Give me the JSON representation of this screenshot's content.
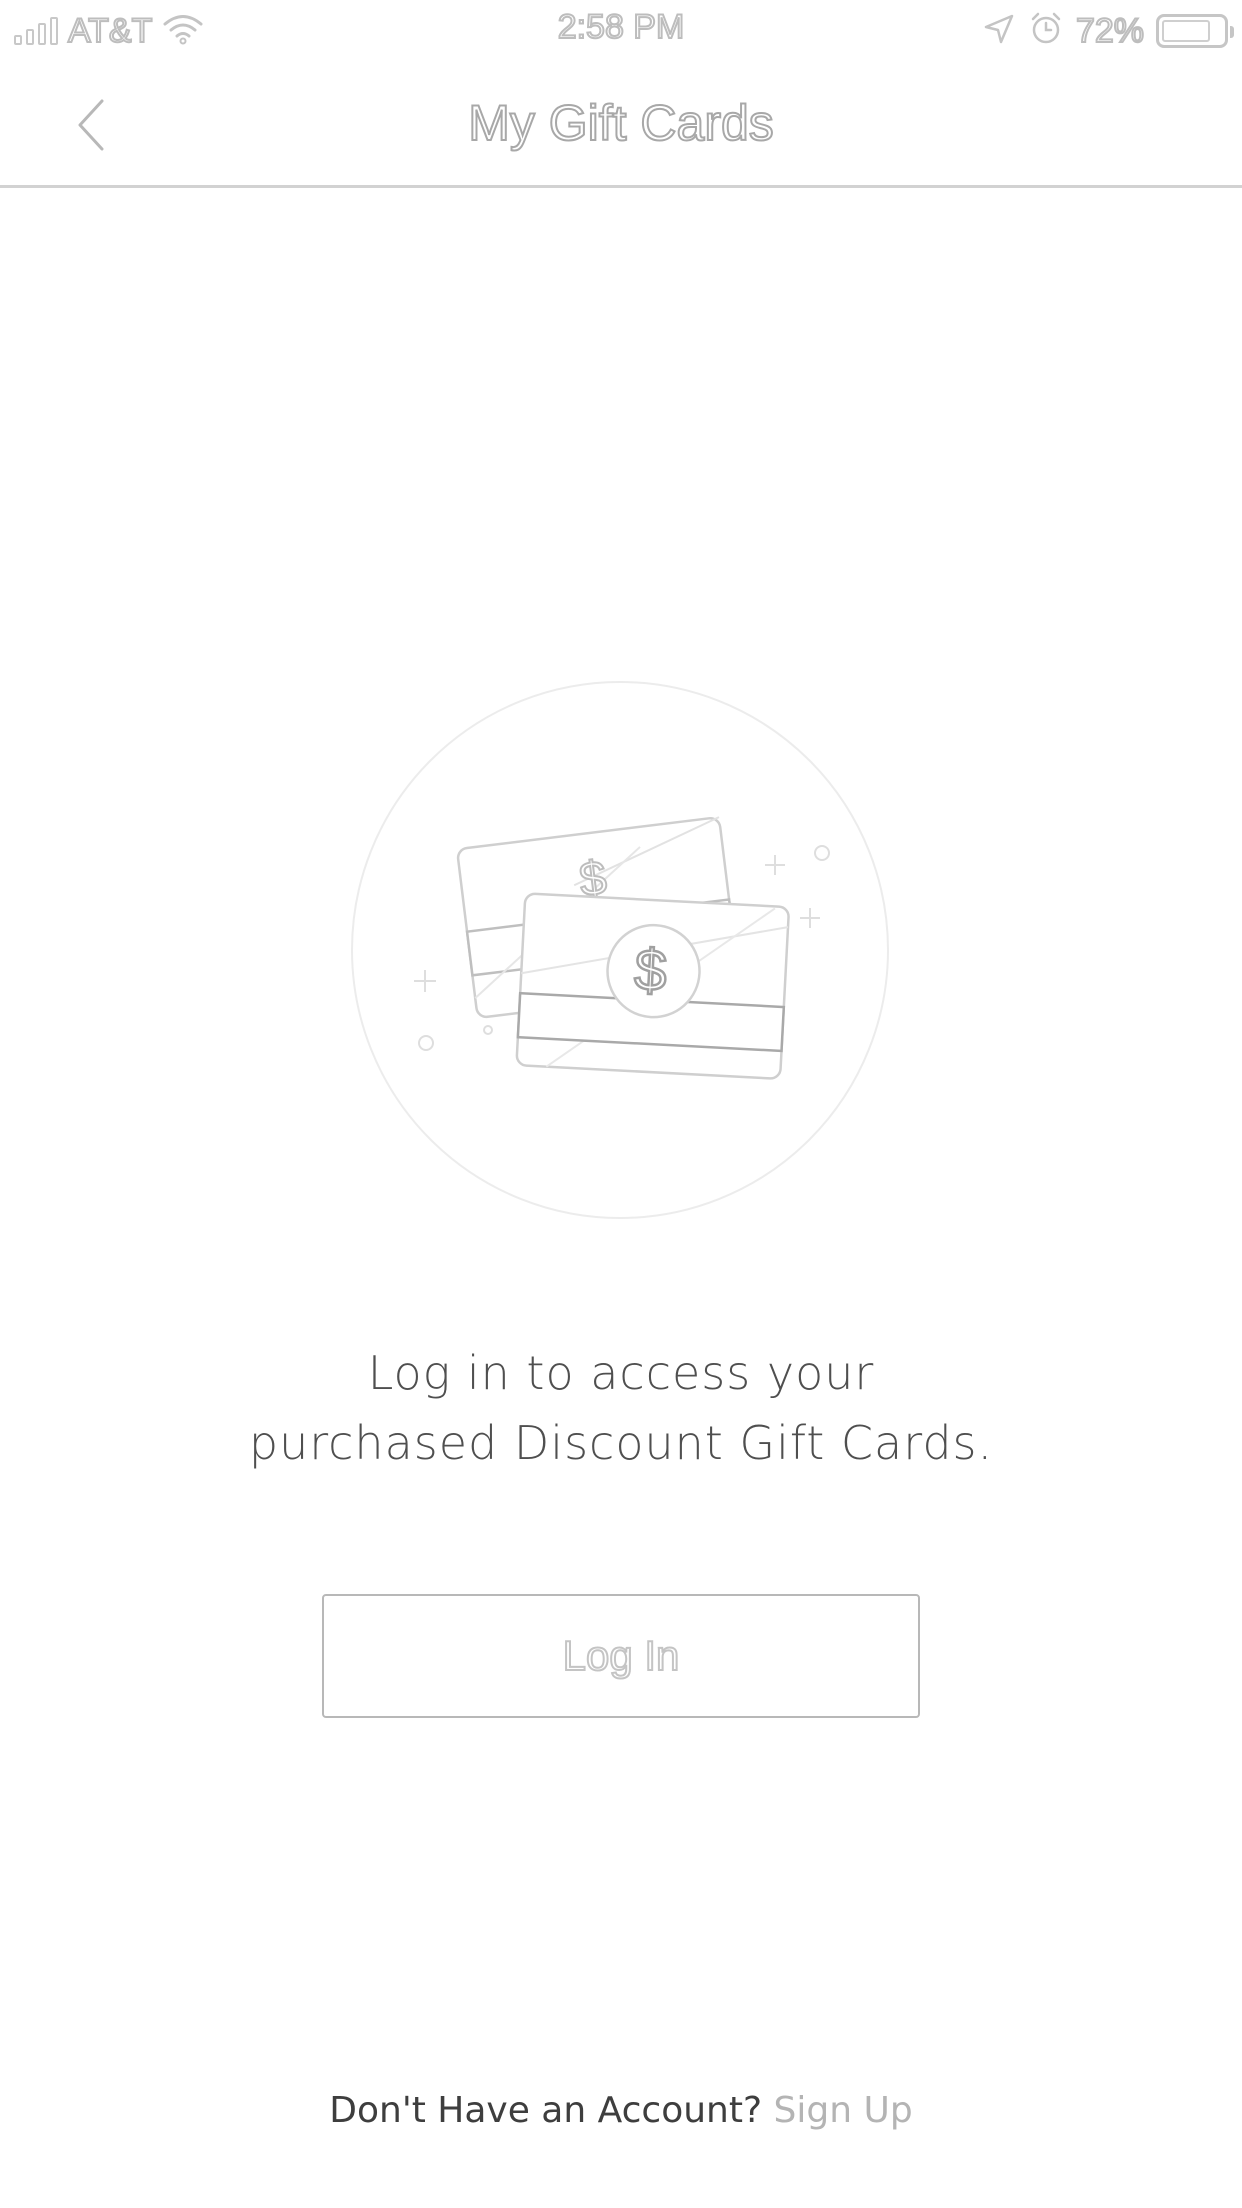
{
  "status_bar": {
    "carrier": "AT&T",
    "time": "2:58 PM",
    "battery_percent": "72%",
    "icons": [
      "signal-icon",
      "wifi-icon",
      "location-icon",
      "alarm-icon",
      "battery-icon"
    ]
  },
  "nav": {
    "title": "My Gift Cards",
    "back_icon": "chevron-left-icon"
  },
  "illustration": {
    "icon": "gift-cards-icon",
    "symbol": "$"
  },
  "message": {
    "line1": "Log in to access your",
    "line2": "purchased Discount Gift Cards."
  },
  "login_button": {
    "label": "Log In"
  },
  "footer": {
    "prompt": "Don't Have an Account?",
    "signup_label": "Sign Up"
  },
  "colors": {
    "text_dark": "#4f4f4f",
    "outline_gray": "#bdbdbd",
    "link_gray": "#b4b4b4",
    "background": "#ffffff"
  }
}
